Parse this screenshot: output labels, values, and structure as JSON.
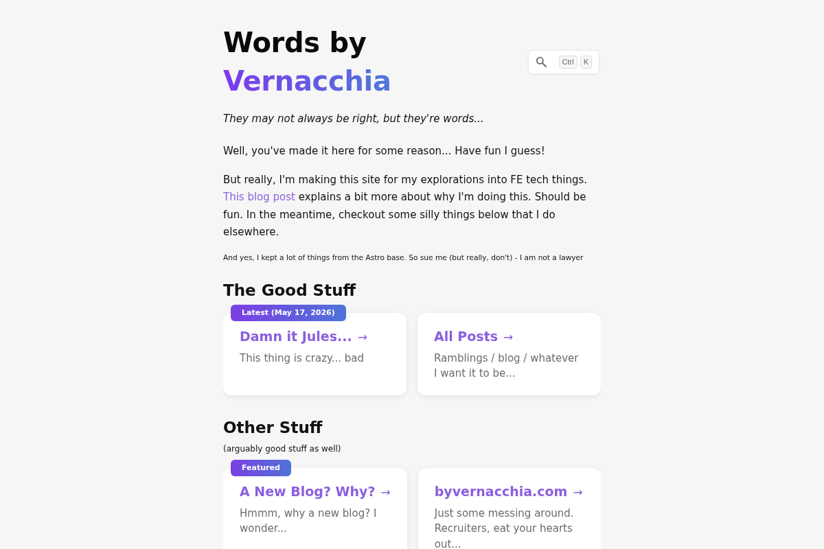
{
  "header": {
    "title_line_1": "Words by",
    "title_line_2": "Vernacchia",
    "search": {
      "shortcut_keys": [
        "Ctrl",
        "K"
      ]
    }
  },
  "tagline": "They may not always be right, but they're words...",
  "intro": {
    "paragraph_1": "Well, you've made it here for some reason... Have fun I guess!",
    "paragraph_2": {
      "before_link": "But really, I'm making this site for my explorations into FE tech things.",
      "link": "This blog post",
      "after_link": "explains a bit more about why I'm doing this. Should be fun. In the meantime, checkout some silly things below that I do elsewhere."
    },
    "note": "And yes, I kept a lot of things from the Astro base. So sue me (but really, don't) - I am not a lawyer"
  },
  "sections": [
    {
      "title": "The Good Stuff",
      "cards": [
        {
          "badge": "Latest (May 17, 2026)",
          "title": "Damn it Jules...",
          "arrow": "→",
          "description": "This thing is crazy... bad"
        },
        {
          "title": "All Posts",
          "arrow": "→",
          "description": "Ramblings / blog / whatever I want it to be..."
        }
      ]
    },
    {
      "title": "Other Stuff",
      "subtitle": "(arguably good stuff as well)",
      "cards": [
        {
          "badge": "Featured",
          "title": "A New Blog? Why?",
          "arrow": "→",
          "description": "Hmmm, why a new blog? I wonder..."
        },
        {
          "title": "byvernacchia.com",
          "arrow": "→",
          "description": "Just some messing around. Recruiters, eat your hearts out..."
        }
      ]
    }
  ]
}
